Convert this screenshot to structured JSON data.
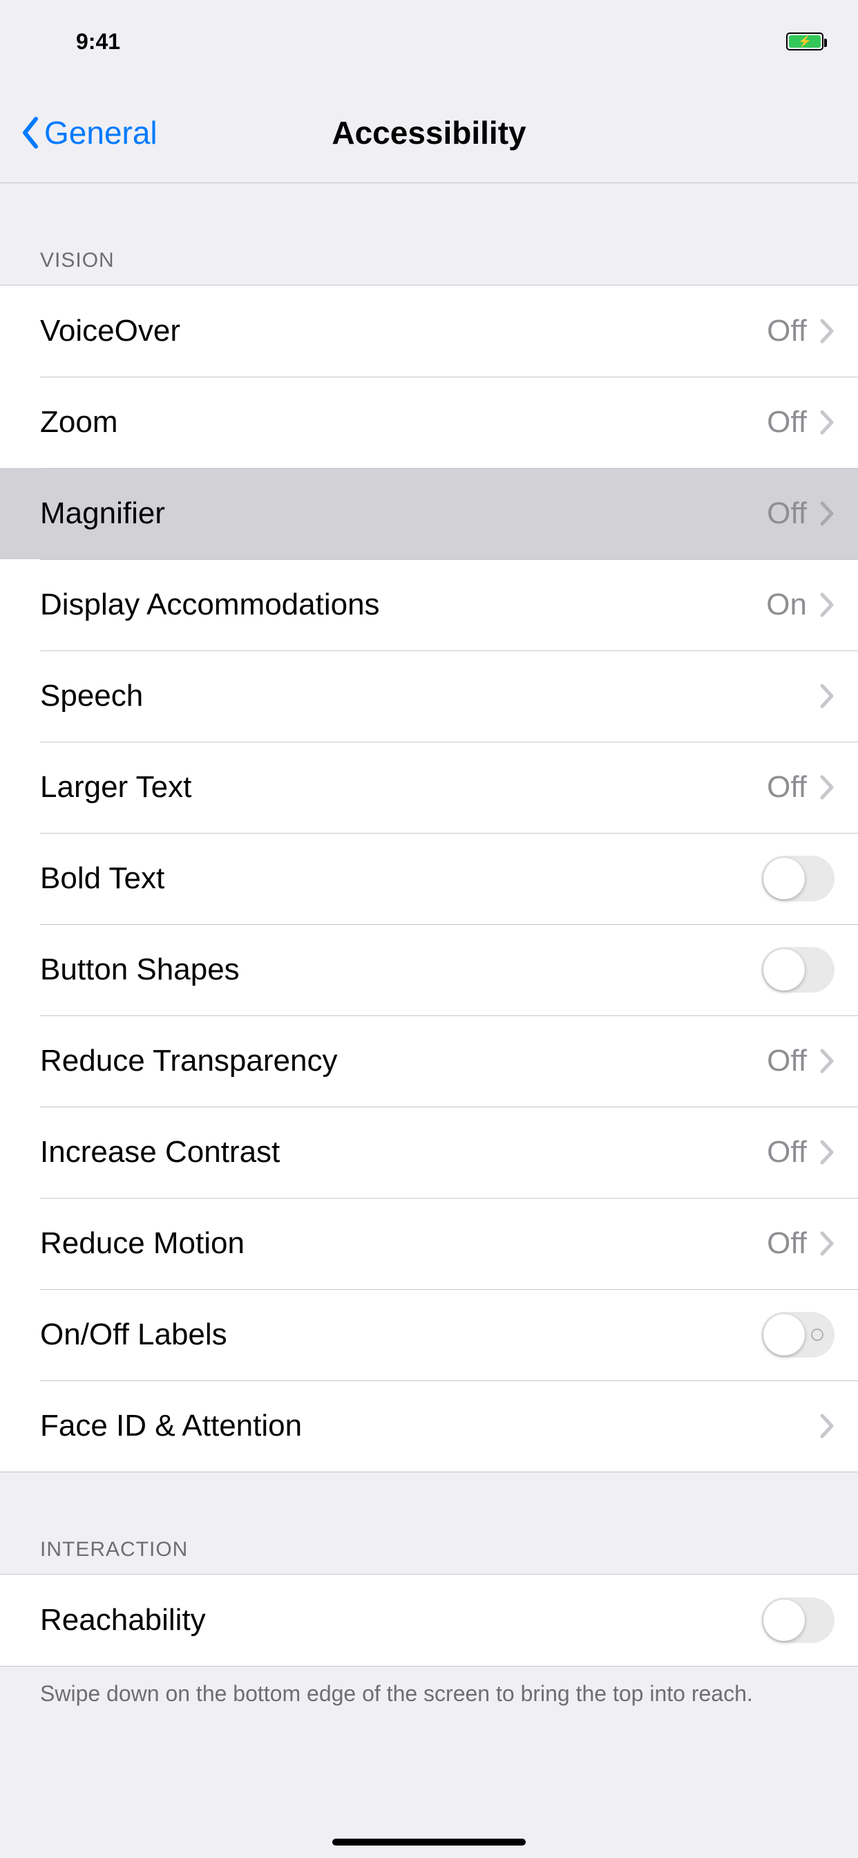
{
  "status_bar": {
    "time": "9:41"
  },
  "nav": {
    "back_label": "General",
    "title": "Accessibility"
  },
  "sections": [
    {
      "header": "Vision",
      "rows": [
        {
          "label": "VoiceOver",
          "value": "Off",
          "type": "disclosure",
          "highlighted": false
        },
        {
          "label": "Zoom",
          "value": "Off",
          "type": "disclosure",
          "highlighted": false
        },
        {
          "label": "Magnifier",
          "value": "Off",
          "type": "disclosure",
          "highlighted": true
        },
        {
          "label": "Display Accommodations",
          "value": "On",
          "type": "disclosure",
          "highlighted": false
        },
        {
          "label": "Speech",
          "value": "",
          "type": "disclosure",
          "highlighted": false
        },
        {
          "label": "Larger Text",
          "value": "Off",
          "type": "disclosure",
          "highlighted": false
        },
        {
          "label": "Bold Text",
          "value": "",
          "type": "toggle",
          "on": false,
          "highlighted": false
        },
        {
          "label": "Button Shapes",
          "value": "",
          "type": "toggle",
          "on": false,
          "highlighted": false
        },
        {
          "label": "Reduce Transparency",
          "value": "Off",
          "type": "disclosure",
          "highlighted": false
        },
        {
          "label": "Increase Contrast",
          "value": "Off",
          "type": "disclosure",
          "highlighted": false
        },
        {
          "label": "Reduce Motion",
          "value": "Off",
          "type": "disclosure",
          "highlighted": false
        },
        {
          "label": "On/Off Labels",
          "value": "",
          "type": "toggle",
          "on": false,
          "show_ring": true,
          "highlighted": false
        },
        {
          "label": "Face ID & Attention",
          "value": "",
          "type": "disclosure",
          "highlighted": false
        }
      ]
    },
    {
      "header": "Interaction",
      "rows": [
        {
          "label": "Reachability",
          "value": "",
          "type": "toggle",
          "on": false,
          "highlighted": false
        }
      ],
      "footer": "Swipe down on the bottom edge of the screen to bring the top into reach."
    }
  ]
}
